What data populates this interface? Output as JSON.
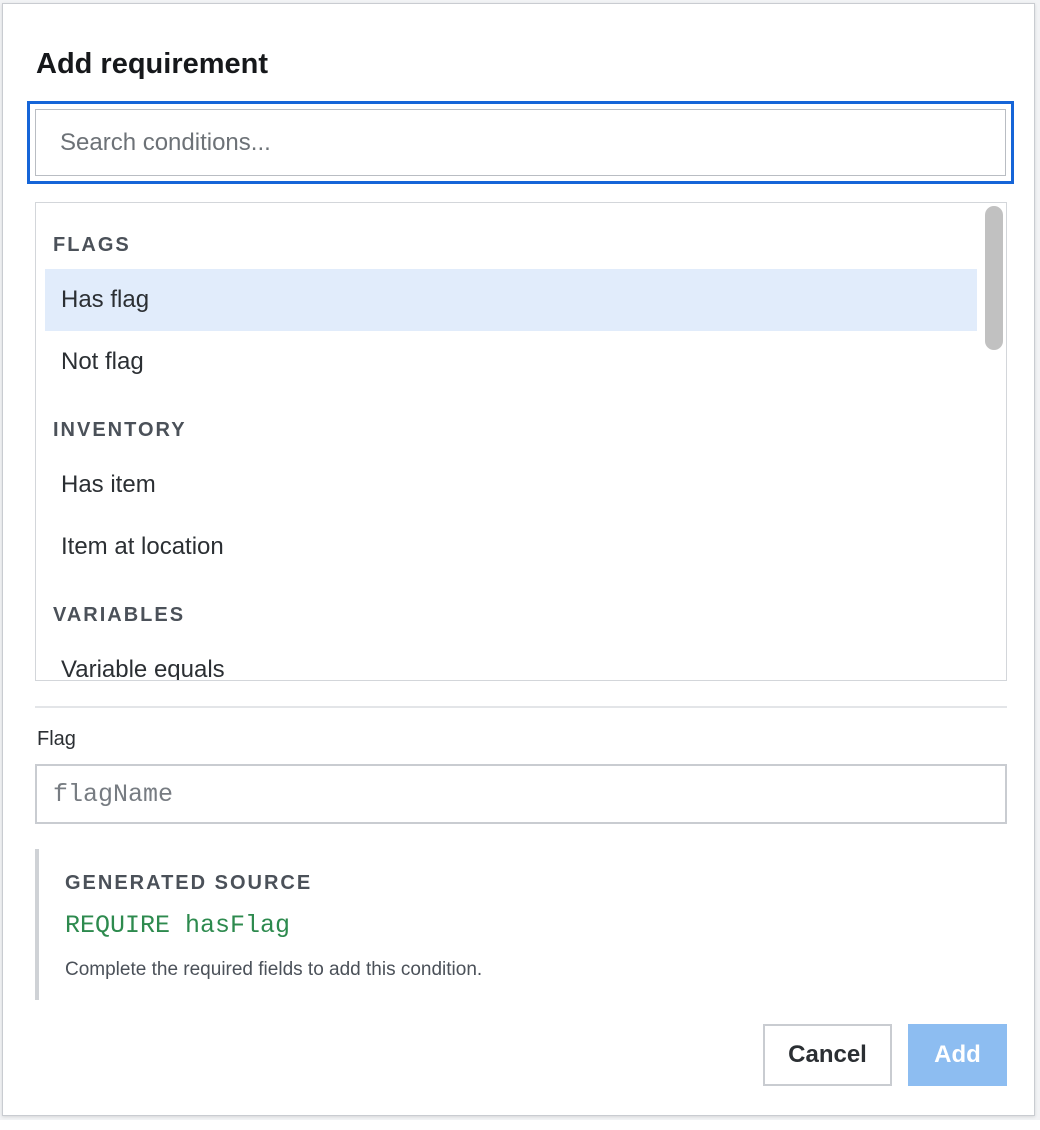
{
  "dialog": {
    "title": "Add requirement"
  },
  "search": {
    "placeholder": "Search conditions...",
    "value": ""
  },
  "list": {
    "groups": [
      {
        "header": "FLAGS",
        "items": [
          {
            "label": "Has flag",
            "selected": true
          },
          {
            "label": "Not flag",
            "selected": false
          }
        ]
      },
      {
        "header": "INVENTORY",
        "items": [
          {
            "label": "Has item",
            "selected": false
          },
          {
            "label": "Item at location",
            "selected": false
          }
        ]
      },
      {
        "header": "VARIABLES",
        "items": [
          {
            "label": "Variable equals",
            "selected": false
          }
        ]
      }
    ]
  },
  "field": {
    "label": "Flag",
    "placeholder": "flagName",
    "value": ""
  },
  "source": {
    "heading": "GENERATED SOURCE",
    "code": "REQUIRE hasFlag",
    "hint": "Complete the required fields to add this condition."
  },
  "actions": {
    "cancel_label": "Cancel",
    "add_label": "Add",
    "add_disabled": true
  },
  "colors": {
    "focus_border": "#1565d8",
    "selected_bg": "#e1ecfb",
    "code_text": "#2d8a4e",
    "add_disabled_bg": "#8dbdf1"
  }
}
